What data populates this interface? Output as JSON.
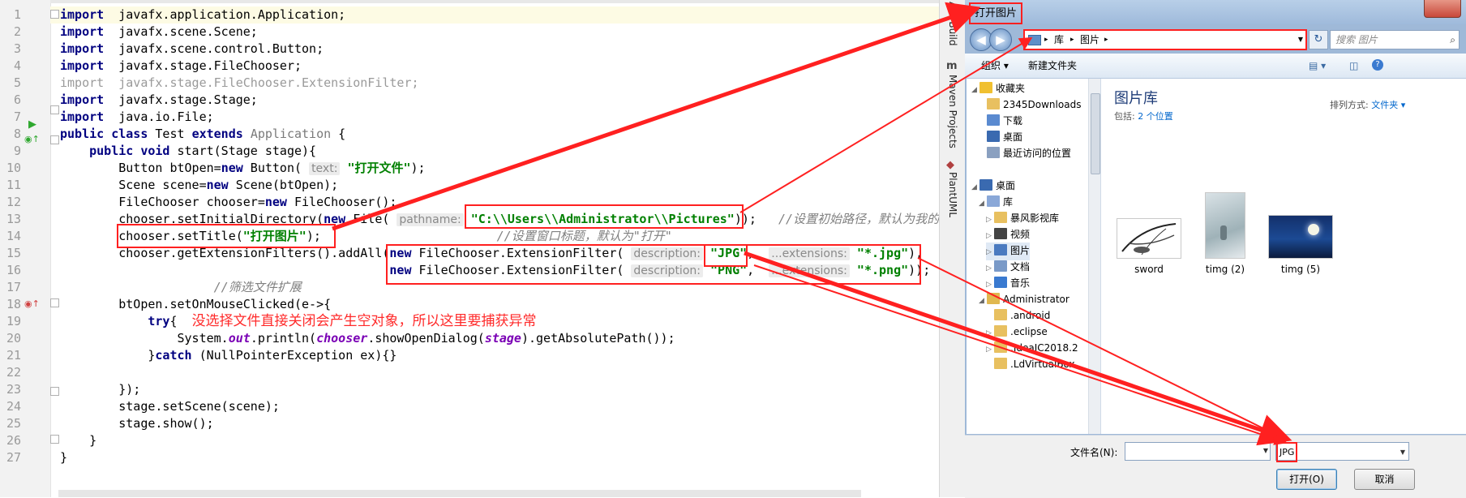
{
  "editor": {
    "lines": [
      {
        "n": "1",
        "parts": [
          [
            "k",
            "import"
          ],
          [
            "",
            "  javafx.application.Application;"
          ]
        ]
      },
      {
        "n": "2",
        "parts": [
          [
            "k",
            "import"
          ],
          [
            "",
            "  javafx.scene.Scene;"
          ]
        ]
      },
      {
        "n": "3",
        "parts": [
          [
            "k",
            "import"
          ],
          [
            "",
            "  javafx.scene.control.Button;"
          ]
        ]
      },
      {
        "n": "4",
        "parts": [
          [
            "k",
            "import"
          ],
          [
            "",
            "  javafx.stage.FileChooser;"
          ]
        ]
      },
      {
        "n": "5",
        "parts": [
          [
            "g",
            "import"
          ],
          [
            "g",
            "  javafx.stage.FileChooser.ExtensionFilter;"
          ]
        ]
      },
      {
        "n": "6",
        "parts": [
          [
            "k",
            "import"
          ],
          [
            "",
            "  javafx.stage.Stage;"
          ]
        ]
      },
      {
        "n": "7",
        "parts": [
          [
            "k",
            "import"
          ],
          [
            "",
            "  java.io.File;"
          ]
        ]
      },
      {
        "n": "8",
        "parts": [
          [
            "k",
            "public class"
          ],
          [
            "",
            " Test "
          ],
          [
            "k",
            "extends"
          ],
          [
            "",
            " "
          ],
          [
            "p",
            "Application"
          ],
          [
            "",
            " {"
          ]
        ]
      },
      {
        "n": "9",
        "parts": [
          [
            "",
            "    "
          ],
          [
            "k",
            "public void"
          ],
          [
            "",
            " start(Stage stage){"
          ]
        ]
      },
      {
        "n": "10",
        "parts": [
          [
            "",
            "        Button btOpen="
          ],
          [
            "k",
            "new"
          ],
          [
            "",
            " Button( "
          ],
          [
            "hint",
            "text:"
          ],
          [
            "",
            " "
          ],
          [
            "s",
            "\"打开文件\""
          ],
          [
            "",
            ");"
          ]
        ]
      },
      {
        "n": "11",
        "parts": [
          [
            "",
            "        Scene scene="
          ],
          [
            "k",
            "new"
          ],
          [
            "",
            " Scene(btOpen);"
          ]
        ]
      },
      {
        "n": "12",
        "parts": [
          [
            "",
            "        FileChooser chooser="
          ],
          [
            "k",
            "new"
          ],
          [
            "",
            " FileChooser();"
          ]
        ]
      },
      {
        "n": "13",
        "parts": [
          [
            "",
            "        chooser.setInitialDirectory("
          ],
          [
            "k",
            "new"
          ],
          [
            "",
            " File( "
          ],
          [
            "hint",
            "pathname:"
          ],
          [
            "",
            " "
          ],
          [
            "s",
            "\"C:\\\\Users\\\\Administrator\\\\Pictures\""
          ],
          [
            "",
            "));   "
          ],
          [
            "c",
            "//设置初始路径，默认为我的"
          ]
        ]
      },
      {
        "n": "14",
        "parts": [
          [
            "",
            "        chooser.setTitle("
          ],
          [
            "s",
            "\"打开图片\""
          ],
          [
            "",
            "); "
          ],
          [
            "c",
            "                       //设置窗口标题，默认为\"打开\""
          ]
        ]
      },
      {
        "n": "15",
        "parts": [
          [
            "",
            "        chooser.getExtensionFilters().addAll("
          ],
          [
            "k",
            "new"
          ],
          [
            "",
            " FileChooser.ExtensionFilter( "
          ],
          [
            "hint",
            "description:"
          ],
          [
            "",
            " "
          ],
          [
            "s",
            "\"JPG\""
          ],
          [
            "",
            ",  "
          ],
          [
            "hint",
            "...extensions:"
          ],
          [
            "",
            " "
          ],
          [
            "s",
            "\"*.jpg\""
          ],
          [
            "",
            "),"
          ]
        ]
      },
      {
        "n": "16",
        "parts": [
          [
            "",
            "                                             "
          ],
          [
            "k",
            "new"
          ],
          [
            "",
            " FileChooser.ExtensionFilter( "
          ],
          [
            "hint",
            "description:"
          ],
          [
            "",
            " "
          ],
          [
            "s",
            "\"PNG\""
          ],
          [
            "",
            ",  "
          ],
          [
            "hint",
            "...extensions:"
          ],
          [
            "",
            " "
          ],
          [
            "s",
            "\"*.png\""
          ],
          [
            "",
            "));"
          ]
        ]
      },
      {
        "n": "17",
        "parts": [
          [
            "c",
            "                     //筛选文件扩展"
          ]
        ]
      },
      {
        "n": "18",
        "parts": [
          [
            "",
            "        btOpen.setOnMouseClicked(e->{"
          ]
        ]
      },
      {
        "n": "19",
        "parts": [
          [
            "",
            "            "
          ],
          [
            "k",
            "try"
          ],
          [
            "",
            "{  "
          ],
          [
            "ann",
            "没选择文件直接关闭会产生空对象，所以这里要捕获异常"
          ]
        ]
      },
      {
        "n": "20",
        "parts": [
          [
            "",
            "                System."
          ],
          [
            "i",
            "out"
          ],
          [
            "",
            ".println("
          ],
          [
            "i",
            "chooser"
          ],
          [
            "",
            ".showOpenDialog("
          ],
          [
            "i",
            "stage"
          ],
          [
            "",
            ").getAbsolutePath());"
          ]
        ]
      },
      {
        "n": "21",
        "parts": [
          [
            "",
            "            }"
          ],
          [
            "k",
            "catch"
          ],
          [
            "",
            " (NullPointerException ex){}"
          ]
        ]
      },
      {
        "n": "22",
        "parts": [
          [
            "",
            ""
          ]
        ]
      },
      {
        "n": "23",
        "parts": [
          [
            "",
            "        });"
          ]
        ]
      },
      {
        "n": "24",
        "parts": [
          [
            "",
            "        stage.setScene(scene);"
          ]
        ]
      },
      {
        "n": "25",
        "parts": [
          [
            "",
            "        stage.show();"
          ]
        ]
      },
      {
        "n": "26",
        "parts": [
          [
            "",
            "    }"
          ]
        ]
      },
      {
        "n": "27",
        "parts": [
          [
            "",
            "}"
          ]
        ]
      }
    ]
  },
  "sidebar": {
    "tab_build": "Ant Build",
    "tab_maven": "Maven Projects",
    "tab_plantuml": "PlantUML",
    "maven_icon": "m"
  },
  "dialog": {
    "title": "打开图片",
    "address": {
      "root_icon": "folder-icon",
      "seg1": "库",
      "seg2": "图片"
    },
    "search_placeholder": "搜索 图片",
    "toolbar": {
      "organize": "组织 ▾",
      "new_folder": "新建文件夹"
    },
    "nav_tree": [
      {
        "label": "收藏夹",
        "icon": "star-icon",
        "tri": "◢",
        "indent": 0
      },
      {
        "label": "2345Downloads",
        "icon": "folder-icon",
        "tri": "",
        "indent": 1
      },
      {
        "label": "下载",
        "icon": "downloads-icon",
        "tri": "",
        "indent": 1
      },
      {
        "label": "桌面",
        "icon": "desktop-icon",
        "tri": "",
        "indent": 1
      },
      {
        "label": "最近访问的位置",
        "icon": "recent-icon",
        "tri": "",
        "indent": 1
      },
      {
        "label": "",
        "icon": "",
        "tri": "",
        "indent": 0
      },
      {
        "label": "桌面",
        "icon": "desktop-icon",
        "tri": "◢",
        "indent": 0
      },
      {
        "label": "库",
        "icon": "library-icon",
        "tri": "◢",
        "indent": 1
      },
      {
        "label": "暴风影视库",
        "icon": "folder-icon",
        "tri": "▷",
        "indent": 2
      },
      {
        "label": "视频",
        "icon": "video-icon",
        "tri": "▷",
        "indent": 2
      },
      {
        "label": "图片",
        "icon": "pictures-icon",
        "tri": "▷",
        "indent": 2,
        "sel": true
      },
      {
        "label": "文档",
        "icon": "documents-icon",
        "tri": "▷",
        "indent": 2
      },
      {
        "label": "音乐",
        "icon": "music-icon",
        "tri": "▷",
        "indent": 2
      },
      {
        "label": "Administrator",
        "icon": "user-folder-icon",
        "tri": "◢",
        "indent": 1
      },
      {
        "label": ".android",
        "icon": "folder-icon",
        "tri": "",
        "indent": 2
      },
      {
        "label": ".eclipse",
        "icon": "folder-icon",
        "tri": "▷",
        "indent": 2
      },
      {
        "label": ".IdeaIC2018.2",
        "icon": "folder-icon",
        "tri": "▷",
        "indent": 2
      },
      {
        "label": ".LdVirtualBox",
        "icon": "folder-icon",
        "tri": "",
        "indent": 2
      }
    ],
    "library": {
      "title": "图片库",
      "includes_prefix": "包括:",
      "includes_link": "2 个位置",
      "sort_label": "排列方式:",
      "sort_value": "文件夹 ▾"
    },
    "files": [
      {
        "name": "sword"
      },
      {
        "name": "timg (2)"
      },
      {
        "name": "timg (5)"
      }
    ],
    "filename_label": "文件名(N):",
    "filename_value": "",
    "filter_value": "JPG",
    "open_label": "打开(O)",
    "cancel_label": "取消"
  },
  "colors": {
    "annotation_red": "#ff2020",
    "keyword": "#000080",
    "string": "#008000"
  }
}
